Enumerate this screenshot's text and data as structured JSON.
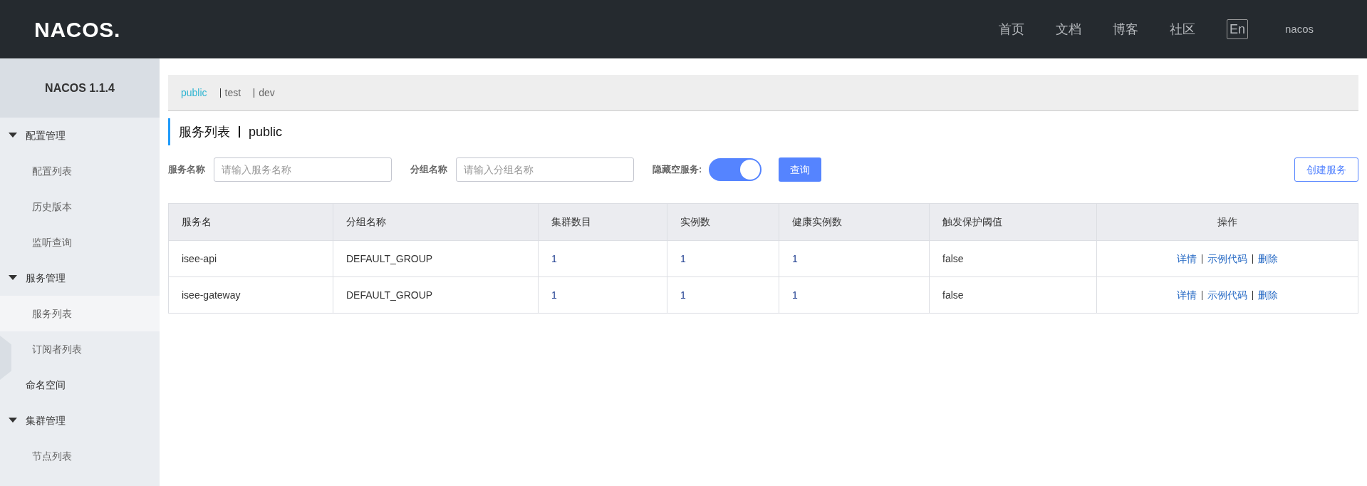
{
  "header": {
    "logo": "NACOS.",
    "nav": [
      "首页",
      "文档",
      "博客",
      "社区"
    ],
    "language": "En",
    "user": "nacos"
  },
  "sidebar": {
    "title": "NACOS 1.1.4",
    "items": [
      {
        "label": "配置管理",
        "expanded": true,
        "children": [
          {
            "label": "配置列表",
            "selected": false
          },
          {
            "label": "历史版本",
            "selected": false
          },
          {
            "label": "监听查询",
            "selected": false
          }
        ]
      },
      {
        "label": "服务管理",
        "expanded": true,
        "children": [
          {
            "label": "服务列表",
            "selected": true
          },
          {
            "label": "订阅者列表",
            "selected": false
          }
        ]
      },
      {
        "label": "命名空间"
      },
      {
        "label": "集群管理",
        "expanded": true,
        "children": [
          {
            "label": "节点列表",
            "selected": false
          }
        ]
      }
    ]
  },
  "namespaces": [
    {
      "label": "public",
      "selected": true
    },
    {
      "label": "test",
      "selected": false
    },
    {
      "label": "dev",
      "selected": false
    }
  ],
  "page_title": {
    "title": "服务列表",
    "namespace": "public"
  },
  "filters": {
    "service_name": {
      "label": "服务名称",
      "placeholder": "请输入服务名称"
    },
    "group_name": {
      "label": "分组名称",
      "placeholder": "请输入分组名称"
    },
    "hide_empty": {
      "label": "隐藏空服务:",
      "on": true
    },
    "query_button": "查询",
    "create_button": "创建服务"
  },
  "table": {
    "columns": [
      "服务名",
      "分组名称",
      "集群数目",
      "实例数",
      "健康实例数",
      "触发保护阈值",
      "操作"
    ],
    "rows": [
      {
        "cells": [
          "isee-api",
          "DEFAULT_GROUP",
          "1",
          "1",
          "1",
          "false"
        ],
        "actions": [
          "详情",
          "示例代码",
          "删除"
        ]
      },
      {
        "cells": [
          "isee-gateway",
          "DEFAULT_GROUP",
          "1",
          "1",
          "1",
          "false"
        ],
        "actions": [
          "详情",
          "示例代码",
          "删除"
        ]
      }
    ]
  }
}
